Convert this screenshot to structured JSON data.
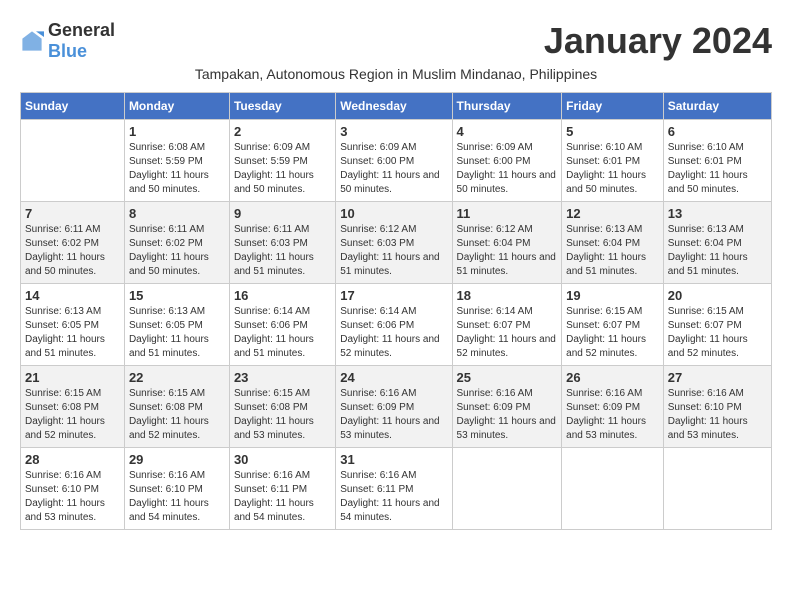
{
  "logo": {
    "general": "General",
    "blue": "Blue"
  },
  "title": "January 2024",
  "subtitle": "Tampakan, Autonomous Region in Muslim Mindanao, Philippines",
  "days_of_week": [
    "Sunday",
    "Monday",
    "Tuesday",
    "Wednesday",
    "Thursday",
    "Friday",
    "Saturday"
  ],
  "weeks": [
    [
      {
        "day": "",
        "sunrise": "",
        "sunset": "",
        "daylight": ""
      },
      {
        "day": "1",
        "sunrise": "Sunrise: 6:08 AM",
        "sunset": "Sunset: 5:59 PM",
        "daylight": "Daylight: 11 hours and 50 minutes."
      },
      {
        "day": "2",
        "sunrise": "Sunrise: 6:09 AM",
        "sunset": "Sunset: 5:59 PM",
        "daylight": "Daylight: 11 hours and 50 minutes."
      },
      {
        "day": "3",
        "sunrise": "Sunrise: 6:09 AM",
        "sunset": "Sunset: 6:00 PM",
        "daylight": "Daylight: 11 hours and 50 minutes."
      },
      {
        "day": "4",
        "sunrise": "Sunrise: 6:09 AM",
        "sunset": "Sunset: 6:00 PM",
        "daylight": "Daylight: 11 hours and 50 minutes."
      },
      {
        "day": "5",
        "sunrise": "Sunrise: 6:10 AM",
        "sunset": "Sunset: 6:01 PM",
        "daylight": "Daylight: 11 hours and 50 minutes."
      },
      {
        "day": "6",
        "sunrise": "Sunrise: 6:10 AM",
        "sunset": "Sunset: 6:01 PM",
        "daylight": "Daylight: 11 hours and 50 minutes."
      }
    ],
    [
      {
        "day": "7",
        "sunrise": "Sunrise: 6:11 AM",
        "sunset": "Sunset: 6:02 PM",
        "daylight": "Daylight: 11 hours and 50 minutes."
      },
      {
        "day": "8",
        "sunrise": "Sunrise: 6:11 AM",
        "sunset": "Sunset: 6:02 PM",
        "daylight": "Daylight: 11 hours and 50 minutes."
      },
      {
        "day": "9",
        "sunrise": "Sunrise: 6:11 AM",
        "sunset": "Sunset: 6:03 PM",
        "daylight": "Daylight: 11 hours and 51 minutes."
      },
      {
        "day": "10",
        "sunrise": "Sunrise: 6:12 AM",
        "sunset": "Sunset: 6:03 PM",
        "daylight": "Daylight: 11 hours and 51 minutes."
      },
      {
        "day": "11",
        "sunrise": "Sunrise: 6:12 AM",
        "sunset": "Sunset: 6:04 PM",
        "daylight": "Daylight: 11 hours and 51 minutes."
      },
      {
        "day": "12",
        "sunrise": "Sunrise: 6:13 AM",
        "sunset": "Sunset: 6:04 PM",
        "daylight": "Daylight: 11 hours and 51 minutes."
      },
      {
        "day": "13",
        "sunrise": "Sunrise: 6:13 AM",
        "sunset": "Sunset: 6:04 PM",
        "daylight": "Daylight: 11 hours and 51 minutes."
      }
    ],
    [
      {
        "day": "14",
        "sunrise": "Sunrise: 6:13 AM",
        "sunset": "Sunset: 6:05 PM",
        "daylight": "Daylight: 11 hours and 51 minutes."
      },
      {
        "day": "15",
        "sunrise": "Sunrise: 6:13 AM",
        "sunset": "Sunset: 6:05 PM",
        "daylight": "Daylight: 11 hours and 51 minutes."
      },
      {
        "day": "16",
        "sunrise": "Sunrise: 6:14 AM",
        "sunset": "Sunset: 6:06 PM",
        "daylight": "Daylight: 11 hours and 51 minutes."
      },
      {
        "day": "17",
        "sunrise": "Sunrise: 6:14 AM",
        "sunset": "Sunset: 6:06 PM",
        "daylight": "Daylight: 11 hours and 52 minutes."
      },
      {
        "day": "18",
        "sunrise": "Sunrise: 6:14 AM",
        "sunset": "Sunset: 6:07 PM",
        "daylight": "Daylight: 11 hours and 52 minutes."
      },
      {
        "day": "19",
        "sunrise": "Sunrise: 6:15 AM",
        "sunset": "Sunset: 6:07 PM",
        "daylight": "Daylight: 11 hours and 52 minutes."
      },
      {
        "day": "20",
        "sunrise": "Sunrise: 6:15 AM",
        "sunset": "Sunset: 6:07 PM",
        "daylight": "Daylight: 11 hours and 52 minutes."
      }
    ],
    [
      {
        "day": "21",
        "sunrise": "Sunrise: 6:15 AM",
        "sunset": "Sunset: 6:08 PM",
        "daylight": "Daylight: 11 hours and 52 minutes."
      },
      {
        "day": "22",
        "sunrise": "Sunrise: 6:15 AM",
        "sunset": "Sunset: 6:08 PM",
        "daylight": "Daylight: 11 hours and 52 minutes."
      },
      {
        "day": "23",
        "sunrise": "Sunrise: 6:15 AM",
        "sunset": "Sunset: 6:08 PM",
        "daylight": "Daylight: 11 hours and 53 minutes."
      },
      {
        "day": "24",
        "sunrise": "Sunrise: 6:16 AM",
        "sunset": "Sunset: 6:09 PM",
        "daylight": "Daylight: 11 hours and 53 minutes."
      },
      {
        "day": "25",
        "sunrise": "Sunrise: 6:16 AM",
        "sunset": "Sunset: 6:09 PM",
        "daylight": "Daylight: 11 hours and 53 minutes."
      },
      {
        "day": "26",
        "sunrise": "Sunrise: 6:16 AM",
        "sunset": "Sunset: 6:09 PM",
        "daylight": "Daylight: 11 hours and 53 minutes."
      },
      {
        "day": "27",
        "sunrise": "Sunrise: 6:16 AM",
        "sunset": "Sunset: 6:10 PM",
        "daylight": "Daylight: 11 hours and 53 minutes."
      }
    ],
    [
      {
        "day": "28",
        "sunrise": "Sunrise: 6:16 AM",
        "sunset": "Sunset: 6:10 PM",
        "daylight": "Daylight: 11 hours and 53 minutes."
      },
      {
        "day": "29",
        "sunrise": "Sunrise: 6:16 AM",
        "sunset": "Sunset: 6:10 PM",
        "daylight": "Daylight: 11 hours and 54 minutes."
      },
      {
        "day": "30",
        "sunrise": "Sunrise: 6:16 AM",
        "sunset": "Sunset: 6:11 PM",
        "daylight": "Daylight: 11 hours and 54 minutes."
      },
      {
        "day": "31",
        "sunrise": "Sunrise: 6:16 AM",
        "sunset": "Sunset: 6:11 PM",
        "daylight": "Daylight: 11 hours and 54 minutes."
      },
      {
        "day": "",
        "sunrise": "",
        "sunset": "",
        "daylight": ""
      },
      {
        "day": "",
        "sunrise": "",
        "sunset": "",
        "daylight": ""
      },
      {
        "day": "",
        "sunrise": "",
        "sunset": "",
        "daylight": ""
      }
    ]
  ]
}
